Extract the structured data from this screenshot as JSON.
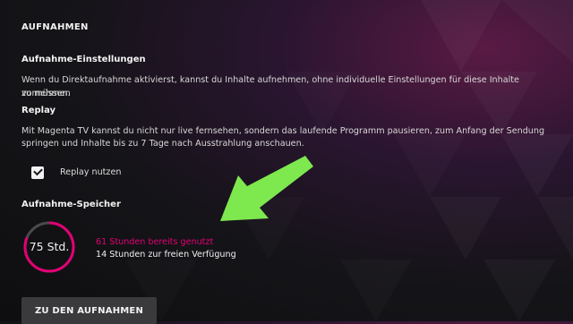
{
  "page": {
    "title": "AUFNAHMEN"
  },
  "recording_settings": {
    "title": "Aufnahme-Einstellungen",
    "text_line1": "Wenn du Direktaufnahme aktivierst, kannst du Inhalte aufnehmen, ohne individuelle Einstellungen für diese Inhalte vornehmen",
    "text_line2": "zu müssen."
  },
  "replay": {
    "title": "Replay",
    "text_line1": "Mit Magenta TV kannst du nicht nur live fernsehen, sondern das laufende Programm pausieren, zum Anfang der Sendung",
    "text_line2": "springen und Inhalte bis zu 7 Tage nach Ausstrahlung anschauen.",
    "checkbox_label": "Replay nutzen",
    "checked": true
  },
  "storage": {
    "title": "Aufnahme-Speicher",
    "gauge_label": "75 Std.",
    "used_text": "61 Stunden bereits genutzt",
    "free_text": "14 Stunden zur freien Verfügung",
    "used_hours": 61,
    "total_hours": 75
  },
  "actions": {
    "recordings_button": "ZU DEN AUFNAHMEN"
  },
  "colors": {
    "accent": "#e20074",
    "arrow": "#7ee84f"
  },
  "icons": {
    "checkbox": "check-icon",
    "annotation": "green-arrow-icon"
  }
}
